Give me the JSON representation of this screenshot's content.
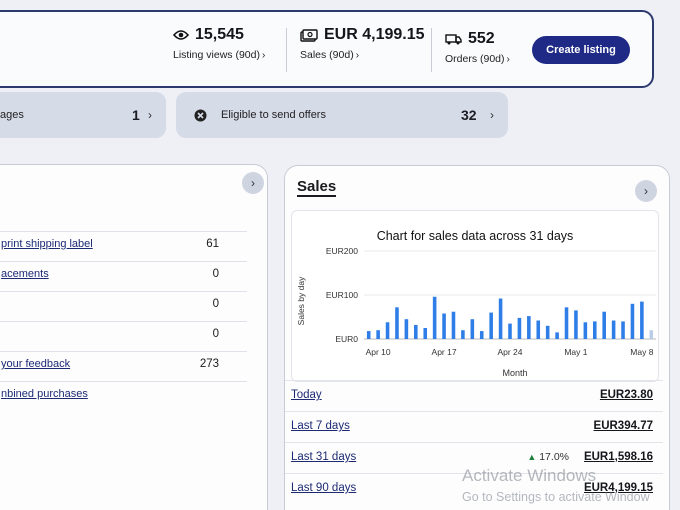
{
  "stats": {
    "views": {
      "value": "15,545",
      "label": "Listing views (90d)"
    },
    "sales": {
      "value": "EUR 4,199.15",
      "label": "Sales (90d)"
    },
    "orders": {
      "value": "552",
      "label": "Orders (90d)"
    }
  },
  "create_listing_label": "Create listing",
  "pills": {
    "left": {
      "text": "ages",
      "count": "1"
    },
    "offers": {
      "text": "Eligible to send offers",
      "count": "32"
    }
  },
  "tasks": [
    {
      "label": "print shipping label",
      "count": "61"
    },
    {
      "label": "acements",
      "count": "0"
    },
    {
      "label": "",
      "count": "0"
    },
    {
      "label": "",
      "count": "0"
    },
    {
      "label": "your feedback",
      "count": "273"
    },
    {
      "label": "nbined purchases",
      "count": ""
    }
  ],
  "sales": {
    "title": "Sales",
    "rows": [
      {
        "period": "Today",
        "change": "",
        "amount": "EUR23.80"
      },
      {
        "period": "Last 7 days",
        "change": "",
        "amount": "EUR394.77"
      },
      {
        "period": "Last 31 days",
        "change": "17.0%",
        "amount": "EUR1,598.16"
      },
      {
        "period": "Last 90 days",
        "change": "",
        "amount": "EUR4,199.15"
      }
    ]
  },
  "chart_data": {
    "type": "bar",
    "title": "Chart for sales data across 31 days",
    "ylabel": "Sales by day",
    "xlabel": "Month",
    "y_ticks": [
      "EUR0",
      "EUR100",
      "EUR200"
    ],
    "ylim": [
      0,
      200
    ],
    "x_ticks": [
      "Apr 10",
      "Apr 17",
      "Apr 24",
      "May 1",
      "May 8"
    ],
    "color": "#2f7ee8",
    "categories": [
      "Apr 9",
      "Apr 10",
      "Apr 11",
      "Apr 12",
      "Apr 13",
      "Apr 14",
      "Apr 15",
      "Apr 16",
      "Apr 17",
      "Apr 18",
      "Apr 19",
      "Apr 20",
      "Apr 21",
      "Apr 22",
      "Apr 23",
      "Apr 24",
      "Apr 25",
      "Apr 26",
      "Apr 27",
      "Apr 28",
      "Apr 29",
      "Apr 30",
      "May 1",
      "May 2",
      "May 3",
      "May 4",
      "May 5",
      "May 6",
      "May 7",
      "May 8",
      "May 9"
    ],
    "values": [
      18,
      20,
      38,
      72,
      45,
      32,
      25,
      96,
      58,
      62,
      20,
      45,
      18,
      60,
      92,
      35,
      48,
      52,
      42,
      30,
      15,
      72,
      65,
      38,
      40,
      62,
      42,
      40,
      80,
      85,
      20
    ]
  },
  "watermark": {
    "line1": "Activate Windows",
    "line2": "Go to Settings to activate Window"
  },
  "colors": {
    "accent": "#1f2a86",
    "bar": "#2f7ee8",
    "link": "#1c2a74"
  }
}
